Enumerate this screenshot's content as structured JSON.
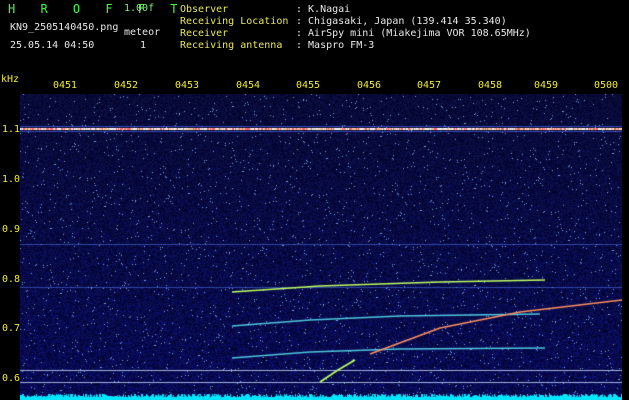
{
  "header": {
    "logo": "H R O F F T",
    "version": "1.00f",
    "filename": "KN9_2505140450.png",
    "meteor_label": "meteor",
    "timestamp": "25.05.14 04:50",
    "meteor_count": "1",
    "fields": [
      {
        "label": "Observer",
        "value": ": K.Nagai"
      },
      {
        "label": "Receiving Location",
        "value": ": Chigasaki, Japan (139.414 35.340)"
      },
      {
        "label": "Receiver",
        "value": ": AirSpy mini (Miakejima VOR 108.65MHz)"
      },
      {
        "label": "Receiving antenna",
        "value": ": Maspro FM-3"
      }
    ]
  },
  "axes": {
    "y_unit": "kHz",
    "x_ticks": [
      "0451",
      "0452",
      "0453",
      "0454",
      "0455",
      "0456",
      "0457",
      "0458",
      "0459",
      "0500"
    ],
    "y_ticks": [
      "1.1",
      "1.0",
      "0.9",
      "0.8",
      "0.7",
      "0.6"
    ]
  },
  "colors": {
    "background": "#000000",
    "tick_text": "#f0ec30",
    "header_label": "#e8e858",
    "header_value": "#e8e8e8",
    "logo": "#3cff3c",
    "noise_floor": "#00e6ff"
  }
}
